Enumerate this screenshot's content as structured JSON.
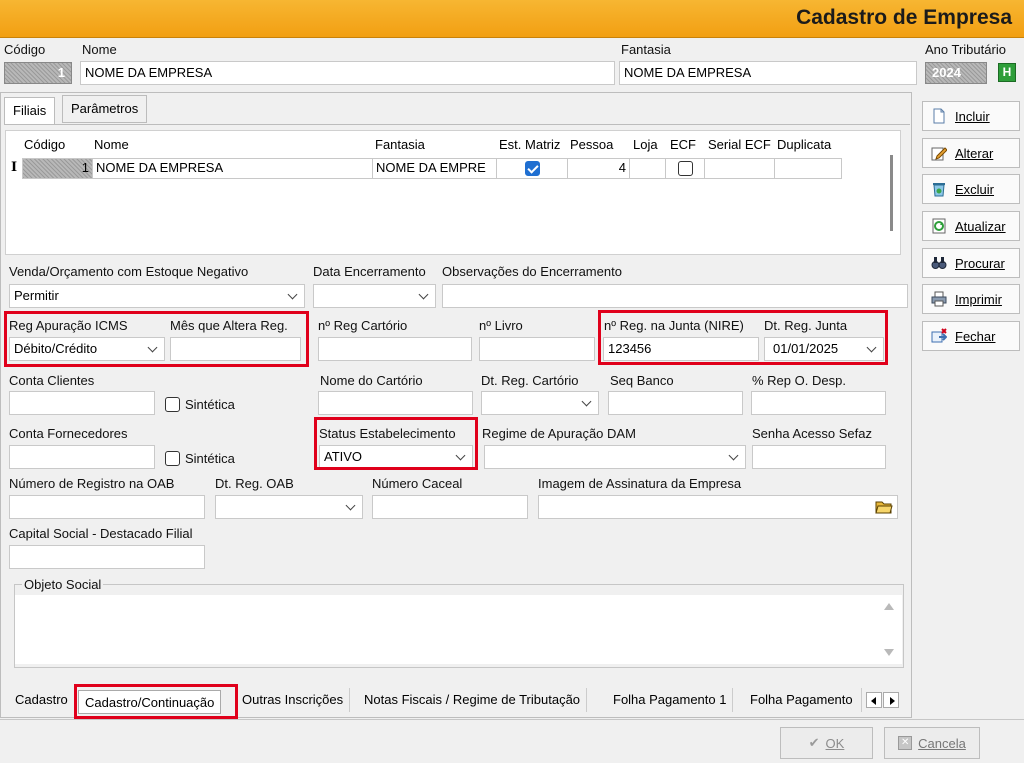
{
  "window": {
    "title": "Cadastro de Empresa"
  },
  "header": {
    "codigo_label": "Código",
    "codigo_value": "1",
    "nome_label": "Nome",
    "nome_value": "NOME DA EMPRESA",
    "fantasia_label": "Fantasia",
    "fantasia_value": "NOME DA EMPRESA",
    "ano_label": "Ano Tributário",
    "ano_value": "2024",
    "ano_badge": "H"
  },
  "tabs": [
    "Filiais",
    "Parâmetros"
  ],
  "grid": {
    "columns": [
      "Código",
      "Nome",
      "Fantasia",
      "Est. Matriz",
      "Pessoa",
      "Loja",
      "ECF",
      "Serial ECF",
      "Duplicata"
    ],
    "row": {
      "marker": "I",
      "codigo": "1",
      "nome": "NOME DA EMPRESA",
      "fantasia": "NOME DA EMPRE",
      "est_matriz": true,
      "pessoa": "4",
      "loja": "",
      "ecf": false,
      "serial": "",
      "duplicata": ""
    }
  },
  "form": {
    "venda_label": "Venda/Orçamento com Estoque Negativo",
    "venda_value": "Permitir",
    "data_enc_label": "Data Encerramento",
    "obs_enc_label": "Observações do Encerramento",
    "reg_icms_label": "Reg Apuração ICMS",
    "reg_icms_value": "Débito/Crédito",
    "mes_altera_label": "Mês que Altera Reg.",
    "reg_cartorio_label": "nº Reg Cartório",
    "livro_label": "nº Livro",
    "nire_label": "nº Reg. na Junta (NIRE)",
    "nire_value": "123456",
    "dt_junta_label": "Dt. Reg. Junta",
    "dt_junta_value": "01/01/2025",
    "conta_cli_label": "Conta Clientes",
    "sintetica_label": "Sintética",
    "nome_cartorio_label": "Nome do Cartório",
    "dt_cartorio_label": "Dt. Reg. Cartório",
    "seq_banco_label": "Seq Banco",
    "rep_desp_label": "% Rep O. Desp.",
    "conta_forn_label": "Conta Fornecedores",
    "status_label": "Status Estabelecimento",
    "status_value": "ATIVO",
    "regime_dam_label": "Regime de Apuração DAM",
    "senha_sefaz_label": "Senha Acesso Sefaz",
    "oab_label": "Número de Registro na OAB",
    "dt_oab_label": "Dt. Reg. OAB",
    "caceal_label": "Número Caceal",
    "assinatura_label": "Imagem de Assinatura da Empresa",
    "capital_label": "Capital Social - Destacado Filial",
    "objeto_label": "Objeto Social"
  },
  "bottom_tabs": [
    "Cadastro",
    "Cadastro/Continuação",
    "Outras Inscrições",
    "Notas Fiscais / Regime de Tributação",
    "Folha Pagamento 1",
    "Folha Pagamento"
  ],
  "side_buttons": [
    {
      "label": "Incluir",
      "icon": "document-icon"
    },
    {
      "label": "Alterar",
      "icon": "pencil-icon"
    },
    {
      "label": "Excluir",
      "icon": "recycle-bin-icon"
    },
    {
      "label": "Atualizar",
      "icon": "refresh-icon"
    },
    {
      "label": "Procurar",
      "icon": "binoculars-icon"
    },
    {
      "label": "Imprimir",
      "icon": "printer-icon"
    },
    {
      "label": "Fechar",
      "icon": "exit-icon"
    }
  ],
  "footer": {
    "ok_label": "OK",
    "cancel_label": "Cancela"
  },
  "colors": {
    "title_bar": "#f29f12",
    "highlight": "#e0001b",
    "checkbox": "#1f6fd1",
    "badge": "#2e9e3a"
  }
}
